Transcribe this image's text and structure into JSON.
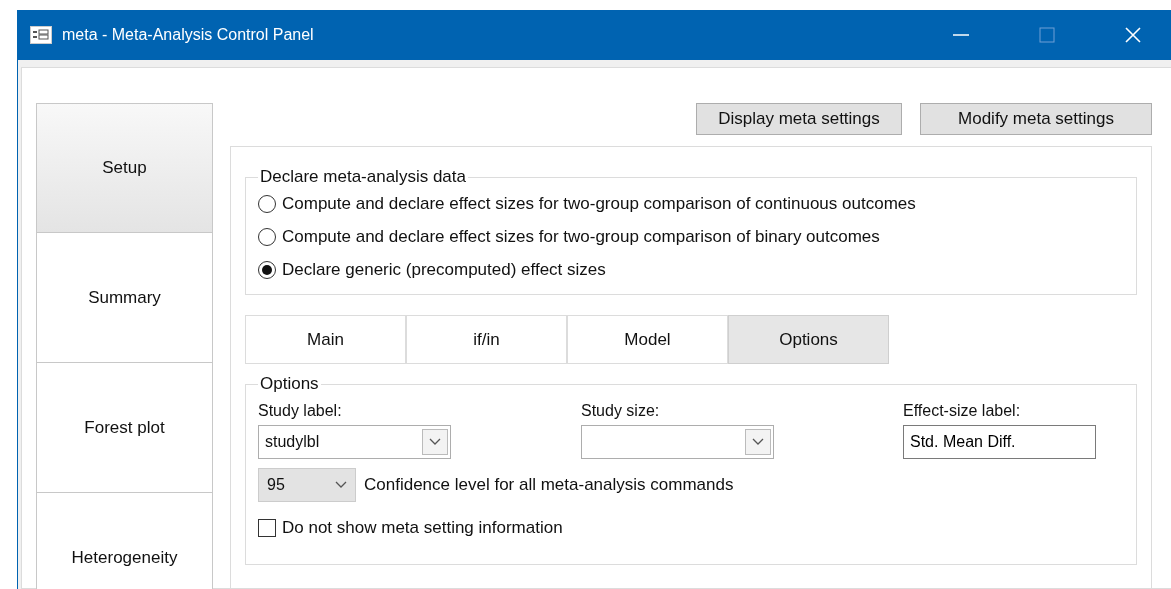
{
  "window": {
    "title": "meta - Meta-Analysis Control Panel"
  },
  "side_tabs": [
    {
      "label": "Setup",
      "selected": true
    },
    {
      "label": "Summary",
      "selected": false
    },
    {
      "label": "Forest plot",
      "selected": false
    },
    {
      "label": "Heterogeneity",
      "selected": false
    }
  ],
  "buttons": [
    "Display meta settings",
    "Modify meta settings"
  ],
  "declare_group": {
    "title": "Declare meta-analysis data",
    "options": [
      {
        "label": "Compute and declare effect sizes for two-group comparison of continuous outcomes",
        "selected": false
      },
      {
        "label": "Compute and declare effect sizes for two-group comparison of binary outcomes",
        "selected": false
      },
      {
        "label": "Declare generic (precomputed) effect sizes",
        "selected": true
      }
    ]
  },
  "tabs": [
    {
      "label": "Main",
      "selected": false
    },
    {
      "label": "if/in",
      "selected": false
    },
    {
      "label": "Model",
      "selected": false
    },
    {
      "label": "Options",
      "selected": true
    }
  ],
  "options_group": {
    "title": "Options",
    "study_label": {
      "label": "Study label:",
      "value": "studylbl"
    },
    "study_size": {
      "label": "Study size:"
    },
    "effect_size_label": {
      "label": "Effect-size label:",
      "value": "Std. Mean Diff."
    },
    "confidence": {
      "value": "95",
      "label": "Confidence level for all meta-analysis commands"
    },
    "hide_settings": {
      "label": "Do not show meta setting information",
      "checked": false
    }
  }
}
